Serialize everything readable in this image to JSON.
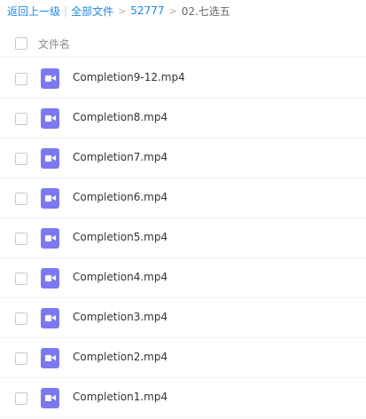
{
  "breadcrumb": {
    "back_label": "返回上一级",
    "pipe": "|",
    "all_files_label": "全部文件",
    "folder_label": "52777",
    "separator": ">",
    "current_label": "02.七选五"
  },
  "table": {
    "column_header": "文件名",
    "files": [
      {
        "name": "Completion9-12.mp4"
      },
      {
        "name": "Completion8.mp4"
      },
      {
        "name": "Completion7.mp4"
      },
      {
        "name": "Completion6.mp4"
      },
      {
        "name": "Completion5.mp4"
      },
      {
        "name": "Completion4.mp4"
      },
      {
        "name": "Completion3.mp4"
      },
      {
        "name": "Completion2.mp4"
      },
      {
        "name": "Completion1.mp4"
      }
    ]
  },
  "icons": {
    "file_icon": "video-file-icon"
  },
  "colors": {
    "link": "#1e88e5",
    "video_icon": "#7b79f2"
  }
}
